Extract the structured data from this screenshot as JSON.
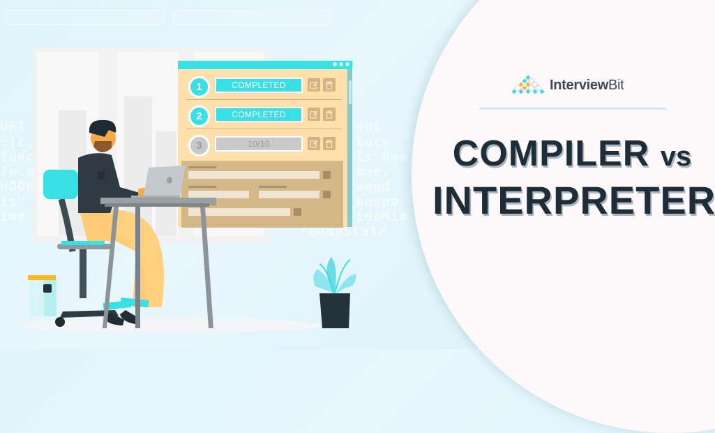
{
  "background": {
    "code_fragments": [
      "URI",
      ":(c,",
      "func",
      "?n.m",
      "HOOK",
      "is\" j",
      "ime",
      "ent",
      "lace",
      "is nam",
      "ame,",
      "wand",
      "anspo",
      "ideMim",
      "readyState"
    ]
  },
  "task_window": {
    "title_dots": 3,
    "tasks": [
      {
        "number": "1",
        "status": "COMPLETED",
        "state": "completed"
      },
      {
        "number": "2",
        "status": "COMPLETED",
        "state": "completed"
      },
      {
        "number": "3",
        "status": "10/10",
        "state": "pending"
      }
    ],
    "colors": {
      "accent": "#38dfe5",
      "panel": "#fde0ab",
      "pending": "#c9c9c9"
    }
  },
  "brand": {
    "name_bold": "Interview",
    "name_light": "Bit",
    "colors": {
      "cyan": "#4fd6dc",
      "orange": "#f7b24a",
      "text": "#3c4b54"
    }
  },
  "headline": {
    "line1": "COMPILER",
    "vs": "vs",
    "line2": "INTERPRETER",
    "color": "#1e2d38"
  }
}
